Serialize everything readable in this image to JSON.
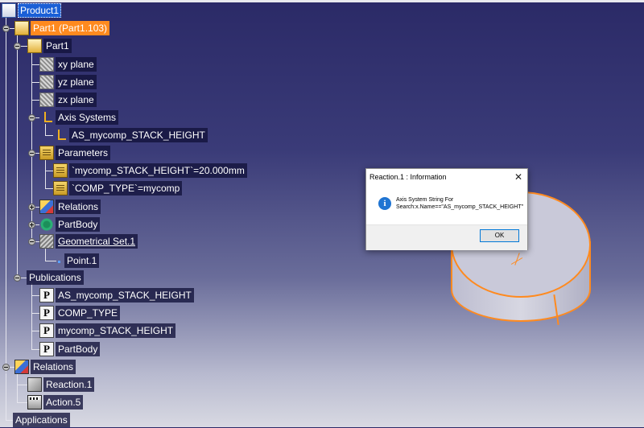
{
  "tree": {
    "product": "Product1",
    "part_instance": "Part1 (Part1.103)",
    "part": "Part1",
    "xy_plane": "xy plane",
    "yz_plane": "yz plane",
    "zx_plane": "zx plane",
    "axis_systems": "Axis Systems",
    "axis_system_item": "AS_mycomp_STACK_HEIGHT",
    "parameters": "Parameters",
    "param_1": "`mycomp_STACK_HEIGHT`=20.000mm",
    "param_2": "`COMP_TYPE`=mycomp",
    "part_relations": "Relations",
    "partbody": "PartBody",
    "geo_set": "Geometrical Set.1",
    "point": "Point.1",
    "publications": "Publications",
    "pub_1": "AS_mycomp_STACK_HEIGHT",
    "pub_2": "COMP_TYPE",
    "pub_3": "mycomp_STACK_HEIGHT",
    "pub_4": "PartBody",
    "relations": "Relations",
    "reaction": "Reaction.1",
    "action": "Action.5",
    "applications": "Applications"
  },
  "dialog": {
    "title": "Reaction.1 : Information",
    "close": "✕",
    "info_glyph": "i",
    "message_line1": "Axis System String For",
    "message_line2": "Search:x.Name==\"AS_mycomp_STACK_HEIGHT\"",
    "ok_label": "OK"
  },
  "icons": {
    "product": "product-icon",
    "part": "part-icon",
    "plane": "plane-icon",
    "axis": "axis-system-icon",
    "parameters": "parameters-icon",
    "publication": "publication-icon",
    "relations": "relations-icon",
    "partbody": "partbody-icon",
    "geoset": "geometrical-set-icon",
    "point": "point-icon",
    "reaction": "reaction-icon",
    "action": "action-icon",
    "info": "info-icon"
  },
  "colors": {
    "selection": "#1a5fd6",
    "highlight": "#ff8a1f",
    "background_top": "#2b2a67",
    "background_bottom": "#d8d9e2"
  }
}
